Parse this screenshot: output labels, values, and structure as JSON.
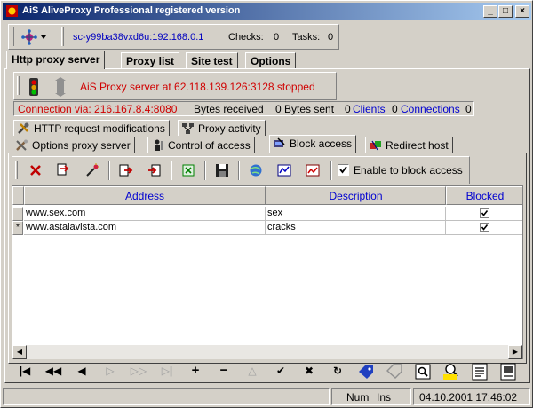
{
  "window": {
    "title": "AiS AliveProxy Professional registered version",
    "controls": {
      "minimize": "_",
      "maximize": "□",
      "close": "×"
    }
  },
  "topbar": {
    "host": "sc-y99ba38vxd6u:192.168.0.1",
    "checks_label": "Checks:",
    "checks_value": "0",
    "tasks_label": "Tasks:",
    "tasks_value": "0"
  },
  "main_tabs": [
    {
      "label": "Http proxy server",
      "active": true
    },
    {
      "label": "Proxy list",
      "active": false
    },
    {
      "label": "Site test",
      "active": false
    },
    {
      "label": "Options",
      "active": false
    }
  ],
  "server": {
    "status_text": "AiS Proxy server at 62.118.139.126:3128 stopped"
  },
  "connection": {
    "via": "Connection via: 216.167.8.4:8080",
    "bytes_received_label": "Bytes received",
    "bytes_received": "0",
    "bytes_sent_label": "Bytes sent",
    "bytes_sent": "0",
    "clients_label": "Clients",
    "clients": "0",
    "connections_label": "Connections",
    "connections": "0"
  },
  "sub_tabs_row1": [
    {
      "label": "HTTP request modifications",
      "icon": "tools-icon"
    },
    {
      "label": "Proxy activity",
      "icon": "network-icon"
    }
  ],
  "sub_tabs_row2": [
    {
      "label": "Options proxy server",
      "icon": "wrench-icon",
      "active": false
    },
    {
      "label": "Control of access",
      "icon": "person-icon",
      "active": false
    },
    {
      "label": "Block access",
      "icon": "block-icon",
      "active": true
    },
    {
      "label": "Redirect host",
      "icon": "redirect-icon",
      "active": false
    }
  ],
  "block_toolbar": {
    "enable_label": "Enable to block access",
    "enable_checked": true
  },
  "grid": {
    "columns": [
      "Address",
      "Description",
      "Blocked"
    ],
    "rows": [
      {
        "indicator": "",
        "address": "www.sex.com",
        "description": "sex",
        "blocked": true
      },
      {
        "indicator": "*",
        "address": "www.astalavista.com",
        "description": "cracks",
        "blocked": true
      }
    ]
  },
  "navigator": {
    "buttons": [
      {
        "name": "first-record-button",
        "glyph": "|◀",
        "enabled": true
      },
      {
        "name": "prior-page-button",
        "glyph": "◀◀",
        "enabled": true
      },
      {
        "name": "prior-record-button",
        "glyph": "◀",
        "enabled": true
      },
      {
        "name": "next-record-button",
        "glyph": "▷",
        "enabled": false
      },
      {
        "name": "next-page-button",
        "glyph": "▷▷",
        "enabled": false
      },
      {
        "name": "last-record-button",
        "glyph": "▷|",
        "enabled": false
      },
      {
        "name": "insert-record-button",
        "glyph": "+",
        "enabled": true
      },
      {
        "name": "delete-record-button",
        "glyph": "−",
        "enabled": true
      },
      {
        "name": "edit-record-button",
        "glyph": "△",
        "enabled": false
      },
      {
        "name": "post-record-button",
        "glyph": "✔",
        "enabled": true
      },
      {
        "name": "cancel-record-button",
        "glyph": "✖",
        "enabled": true
      },
      {
        "name": "refresh-button",
        "glyph": "↻",
        "enabled": true
      }
    ]
  },
  "statusbar": {
    "num": "Num",
    "ins": "Ins",
    "datetime": "04.10.2001 17:46:02"
  }
}
